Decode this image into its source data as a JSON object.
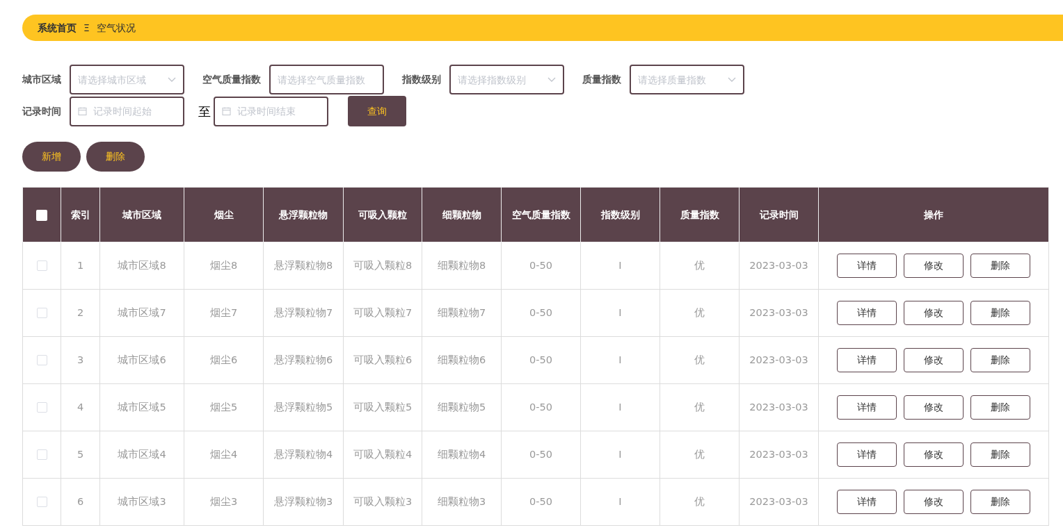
{
  "breadcrumb": {
    "home": "系统首页",
    "separator": "Ξ",
    "current": "空气状况"
  },
  "filters": [
    {
      "kind": "select",
      "label": "城市区域",
      "placeholder": "请选择城市区域"
    },
    {
      "kind": "input",
      "label": "空气质量指数",
      "placeholder": "请选择空气质量指数"
    },
    {
      "kind": "select",
      "label": "指数级别",
      "placeholder": "请选择指数级别"
    },
    {
      "kind": "select",
      "label": "质量指数",
      "placeholder": "请选择质量指数"
    }
  ],
  "date_range": {
    "label": "记录时间",
    "start_placeholder": "记录时间起始",
    "separator": "至",
    "end_placeholder": "记录时间结束"
  },
  "search_button": "查询",
  "actions": [
    "新增",
    "删除"
  ],
  "table": {
    "select_all_checked": false,
    "columns": [
      "索引",
      "城市区域",
      "烟尘",
      "悬浮颗粒物",
      "可吸入颗粒",
      "细颗粒物",
      "空气质量指数",
      "指数级别",
      "质量指数",
      "记录时间",
      "操作"
    ],
    "rows": [
      {
        "checked": false,
        "cells": [
          "1",
          "城市区域8",
          "烟尘8",
          "悬浮颗粒物8",
          "可吸入颗粒8",
          "细颗粒物8",
          "0-50",
          "I",
          "优",
          "2023-03-03"
        ],
        "buttons": [
          "详情",
          "修改",
          "删除"
        ]
      },
      {
        "checked": false,
        "cells": [
          "2",
          "城市区域7",
          "烟尘7",
          "悬浮颗粒物7",
          "可吸入颗粒7",
          "细颗粒物7",
          "0-50",
          "I",
          "优",
          "2023-03-03"
        ],
        "buttons": [
          "详情",
          "修改",
          "删除"
        ]
      },
      {
        "checked": false,
        "cells": [
          "3",
          "城市区域6",
          "烟尘6",
          "悬浮颗粒物6",
          "可吸入颗粒6",
          "细颗粒物6",
          "0-50",
          "I",
          "优",
          "2023-03-03"
        ],
        "buttons": [
          "详情",
          "修改",
          "删除"
        ]
      },
      {
        "checked": false,
        "cells": [
          "4",
          "城市区域5",
          "烟尘5",
          "悬浮颗粒物5",
          "可吸入颗粒5",
          "细颗粒物5",
          "0-50",
          "I",
          "优",
          "2023-03-03"
        ],
        "buttons": [
          "详情",
          "修改",
          "删除"
        ]
      },
      {
        "checked": false,
        "cells": [
          "5",
          "城市区域4",
          "烟尘4",
          "悬浮颗粒物4",
          "可吸入颗粒4",
          "细颗粒物4",
          "0-50",
          "I",
          "优",
          "2023-03-03"
        ],
        "buttons": [
          "详情",
          "修改",
          "删除"
        ]
      },
      {
        "checked": false,
        "cells": [
          "6",
          "城市区域3",
          "烟尘3",
          "悬浮颗粒物3",
          "可吸入颗粒3",
          "细颗粒物3",
          "0-50",
          "I",
          "优",
          "2023-03-03"
        ],
        "buttons": [
          "详情",
          "修改",
          "删除"
        ]
      }
    ]
  }
}
